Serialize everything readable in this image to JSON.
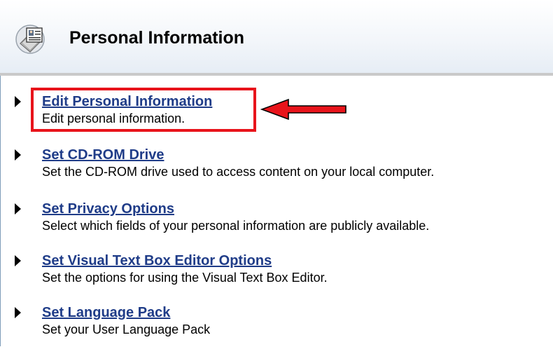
{
  "header": {
    "title": "Personal Information",
    "icon": "personal-info-card-icon"
  },
  "items": [
    {
      "label": "Edit Personal Information",
      "description": "Edit personal information."
    },
    {
      "label": "Set CD-ROM Drive",
      "description": "Set the CD-ROM drive used to access content on your local computer."
    },
    {
      "label": "Set Privacy Options",
      "description": "Select which fields of your personal information are publicly available."
    },
    {
      "label": "Set Visual Text Box Editor Options",
      "description": "Set the options for using the Visual Text Box Editor."
    },
    {
      "label": "Set Language Pack",
      "description": "Set your User Language Pack"
    }
  ],
  "annotation": {
    "highlight_color": "#e8141b",
    "arrow_icon": "red-arrow-pointing-left-icon",
    "highlighted_item": "Edit Personal Information"
  },
  "colors": {
    "link": "#1f3c88",
    "header_rule": "#c9c9c9",
    "border": "#7f9db9"
  }
}
